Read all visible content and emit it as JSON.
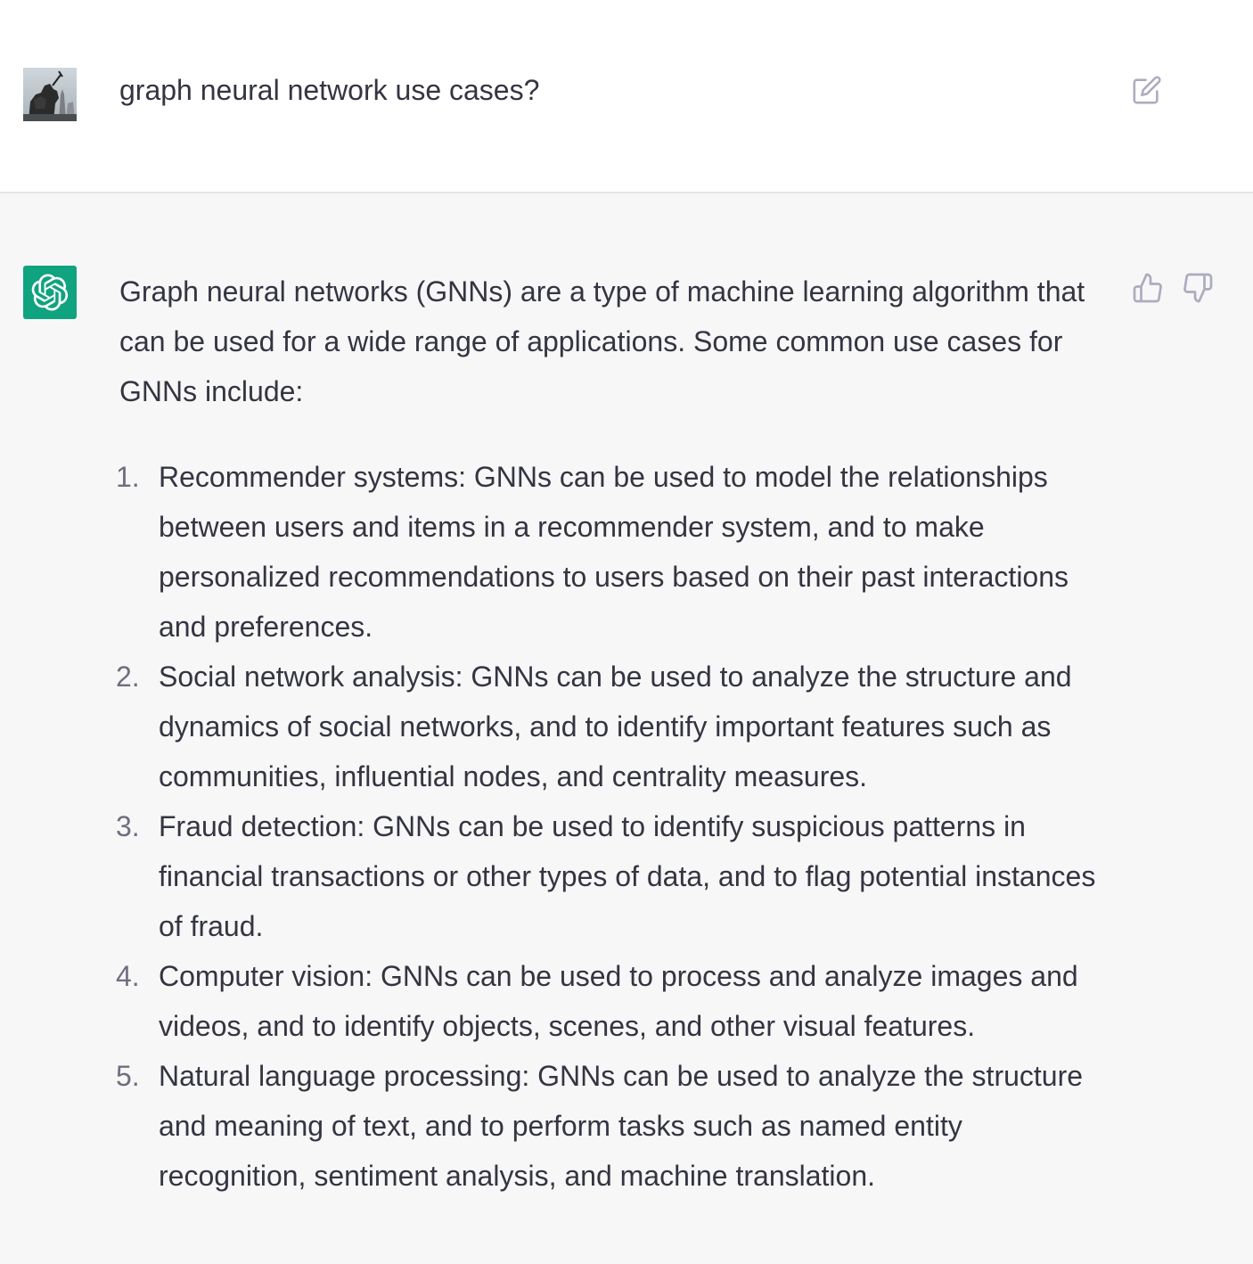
{
  "user_message": {
    "text": "graph neural network use cases?"
  },
  "icons": {
    "user_avatar": "user-avatar-statue-photo",
    "assistant_avatar": "openai-logo-icon",
    "edit": "edit-icon",
    "thumbs_up": "thumbs-up-icon",
    "thumbs_down": "thumbs-down-icon"
  },
  "colors": {
    "assistant_avatar_bg": "#10a37f",
    "assistant_row_bg": "#f7f7f8",
    "text": "#343541",
    "icon": "#acacbe"
  },
  "assistant_message": {
    "intro": "Graph neural networks (GNNs) are a type of machine learning algorithm that can be used for a wide range of applications. Some common use cases for GNNs include:",
    "items": [
      {
        "num": "1.",
        "text": "Recommender systems: GNNs can be used to model the relationships between users and items in a recommender system, and to make personalized recommendations to users based on their past interactions and preferences."
      },
      {
        "num": "2.",
        "text": "Social network analysis: GNNs can be used to analyze the structure and dynamics of social networks, and to identify important features such as communities, influential nodes, and centrality measures."
      },
      {
        "num": "3.",
        "text": "Fraud detection: GNNs can be used to identify suspicious patterns in financial transactions or other types of data, and to flag potential instances of fraud."
      },
      {
        "num": "4.",
        "text": "Computer vision: GNNs can be used to process and analyze images and videos, and to identify objects, scenes, and other visual features."
      },
      {
        "num": "5.",
        "text": "Natural language processing: GNNs can be used to analyze the structure and meaning of text, and to perform tasks such as named entity recognition, sentiment analysis, and machine translation."
      }
    ]
  }
}
